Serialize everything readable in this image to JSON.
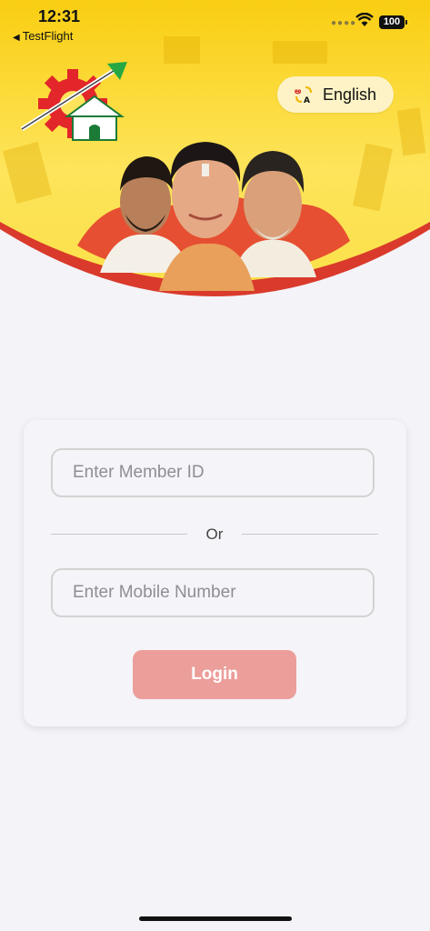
{
  "status_bar": {
    "time": "12:31",
    "back_app": "TestFlight",
    "back_icon": "back-triangle-icon",
    "battery": "100",
    "signal_icon": "cellular-dots-icon",
    "wifi_icon": "wifi-icon"
  },
  "header": {
    "logo_icon": "party-logo-icon",
    "banner": "leaders-banner-image",
    "language_button": {
      "label": "English",
      "icon": "translate-icon"
    }
  },
  "login_form": {
    "member_id_placeholder": "Enter Member ID",
    "member_id_value": "",
    "separator_text": "Or",
    "mobile_placeholder": "Enter Mobile Number",
    "mobile_value": "",
    "login_label": "Login"
  },
  "colors": {
    "header_yellow": "#fbd81f",
    "accent_red": "#d93a2b",
    "login_button": "#ec9e9a",
    "background": "#f4f3f8"
  }
}
